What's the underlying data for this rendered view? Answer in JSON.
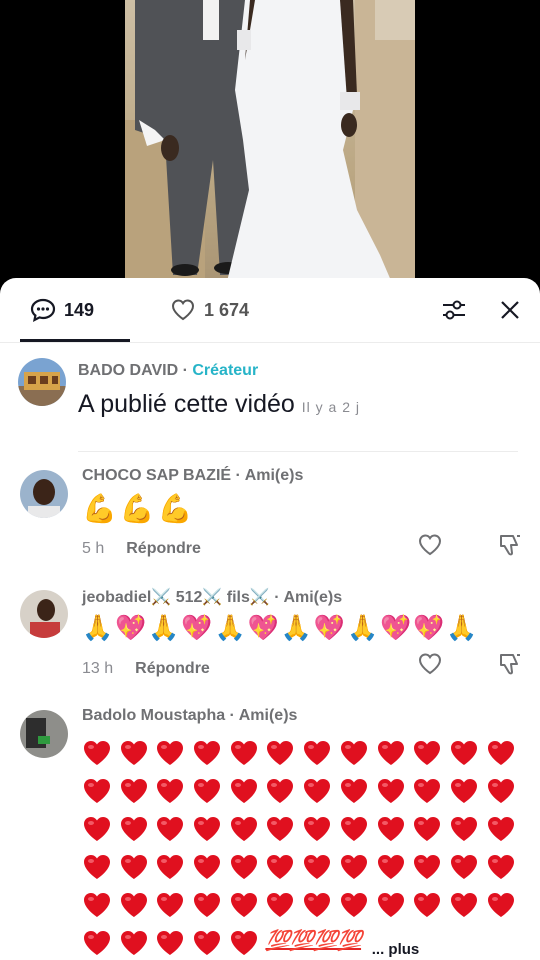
{
  "tabs": {
    "comments_count": "149",
    "likes_count": "1 674"
  },
  "creator_post": {
    "author": "BADO DAVID",
    "separator": " · ",
    "role": "Créateur",
    "text": "A publié cette vidéo",
    "time": "Il y a 2 j"
  },
  "comments": [
    {
      "author": "CHOCO SAP BAZIÉ",
      "relation": "Ami(e)s",
      "text": "💪💪💪",
      "time": "5 h",
      "reply_label": "Répondre"
    },
    {
      "author": "jeobadiel⚔️ 512⚔️ fils⚔️",
      "relation": "Ami(e)s",
      "text": "🙏💖🙏💖🙏💖🙏💖🙏💖💖🙏",
      "time": "13 h",
      "reply_label": "Répondre"
    },
    {
      "author": "Badolo Moustapha",
      "relation": "Ami(e)s",
      "hundreds": "💯💯💯💯",
      "more_label": "... plus"
    }
  ],
  "colors": {
    "heart": "#e0101f",
    "role": "#27b4c8"
  },
  "icons": [
    "comment-icon",
    "heart-outline-icon",
    "filter-sliders-icon",
    "close-icon",
    "like-icon",
    "dislike-icon",
    "muscle-emoji",
    "pray-emoji",
    "sparkling-heart-emoji",
    "red-heart-emoji",
    "hundred-emoji"
  ]
}
